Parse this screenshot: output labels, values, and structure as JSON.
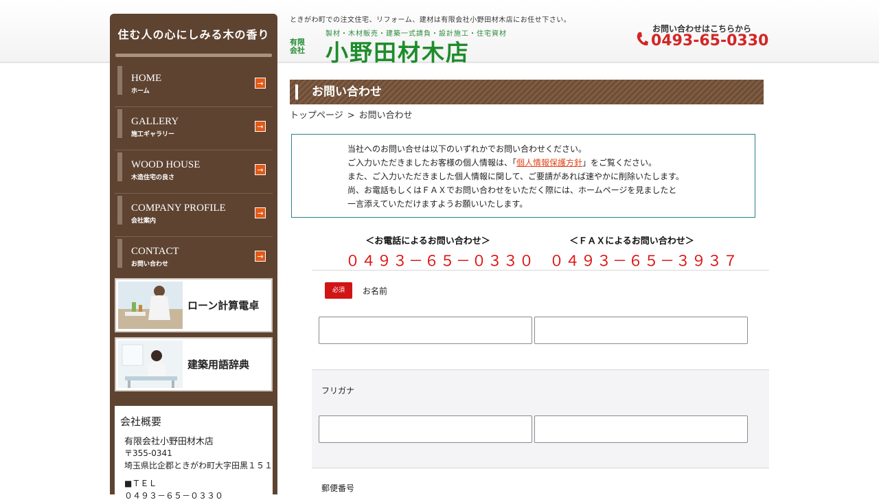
{
  "header": {
    "tagline": "ときがわ町での注文住宅、リフォーム、建材は有限会社小野田材木店にお任せ下さい。",
    "logo_sub": "製材・木材販売・建築一式請負・設計施工・住宅資材",
    "logo_kind": "有限会社",
    "logo_name": "小野田材木店",
    "phone_caption": "お問い合わせはこちらから",
    "phone": "0493-65-0330",
    "brand_green": "#1e8c2c",
    "phone_red": "#d32626"
  },
  "sidebar": {
    "catchphrase": "住む人の心にしみる木の香り",
    "nav": [
      {
        "en": "HOME",
        "ja": "ホーム"
      },
      {
        "en": "GALLERY",
        "ja": "施工ギャラリー"
      },
      {
        "en": "WOOD HOUSE",
        "ja": "木造住宅の良さ"
      },
      {
        "en": "COMPANY PROFILE",
        "ja": "会社案内"
      },
      {
        "en": "CONTACT",
        "ja": "お問い合わせ"
      }
    ],
    "banners": [
      {
        "title": "ローン計算電卓",
        "icon": "kitchen-photo"
      },
      {
        "title": "建築用語辞典",
        "icon": "woman-reading-photo"
      }
    ],
    "company": {
      "title": "会社概要",
      "name": "有限会社小野田材木店",
      "postal": "〒355-0341",
      "address": "埼玉県比企郡ときがわ町大字田黒１５１",
      "tel_label": "■ＴＥＬ",
      "tel": "０４９３－６５－０３３０"
    },
    "brown": "#5e4331"
  },
  "main": {
    "page_title": "お問い合わせ",
    "breadcrumb": {
      "home": "トップページ",
      "separator": ">",
      "current": "お問い合わせ"
    },
    "notice": {
      "line1": "当社へのお問い合せは以下のいずれかでお問い合わせください。",
      "line2_pre": "ご入力いただきましたお客様の個人情報は、「",
      "line2_link": "個人情報保護方針",
      "line2_post": "」をご覧ください。",
      "line3": "また、ご入力いただきました個人情報に関して、ご要請があれば速やかに削除いたします。",
      "line4": "尚、お電話もしくはＦＡＸでお問い合わせをいただく際には、ホームページを見ましたと",
      "line5": "一言添えていただけますようお願いいたします。"
    },
    "contact_phone": {
      "caption": "＜お電話によるお問い合わせ＞",
      "number": "０４９３－６５－０３３０"
    },
    "contact_fax": {
      "caption": "＜ＦＡＸによるお問い合わせ＞",
      "number": "０４９３－６５－３９３７"
    },
    "form": {
      "required_badge": "必須",
      "name_label": "お名前",
      "name_last_value": "",
      "name_first_value": "",
      "kana_label": "フリガナ",
      "kana_last_value": "",
      "kana_first_value": "",
      "postal_label": "郵便番号"
    }
  }
}
